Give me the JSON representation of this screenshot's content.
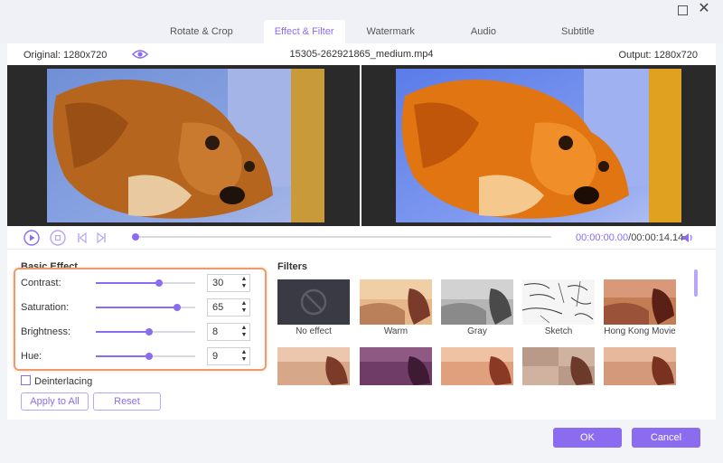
{
  "tabs": [
    {
      "label": "Rotate & Crop"
    },
    {
      "label": "Effect & Filter",
      "active": true
    },
    {
      "label": "Watermark"
    },
    {
      "label": "Audio"
    },
    {
      "label": "Subtitle"
    }
  ],
  "info": {
    "original": "Original: 1280x720",
    "filename": "15305-262921865_medium.mp4",
    "output": "Output: 1280x720"
  },
  "playback": {
    "current_time": "00:00:00.00",
    "separator": "/",
    "total_time": "00:00:14.14",
    "progress": 0.0
  },
  "basic_effect": {
    "title": "Basic Effect",
    "controls": [
      {
        "label": "Contrast:",
        "value": "30",
        "level": 0.64
      },
      {
        "label": "Saturation:",
        "value": "65",
        "level": 0.82
      },
      {
        "label": "Brightness:",
        "value": "8",
        "level": 0.54
      },
      {
        "label": "Hue:",
        "value": "9",
        "level": 0.54
      }
    ],
    "deinterlacing_label": "Deinterlacing",
    "deinterlacing_checked": false,
    "apply_all_label": "Apply to All",
    "reset_label": "Reset"
  },
  "filters": {
    "title": "Filters",
    "items": [
      {
        "label": "No effect"
      },
      {
        "label": "Warm"
      },
      {
        "label": "Gray"
      },
      {
        "label": "Sketch"
      },
      {
        "label": "Hong Kong Movie"
      },
      {
        "label": ""
      },
      {
        "label": ""
      },
      {
        "label": ""
      },
      {
        "label": ""
      },
      {
        "label": ""
      }
    ]
  },
  "footer": {
    "ok_label": "OK",
    "cancel_label": "Cancel"
  },
  "colors": {
    "accent": "#8b6cf0",
    "highlight": "#ef9a6a"
  }
}
